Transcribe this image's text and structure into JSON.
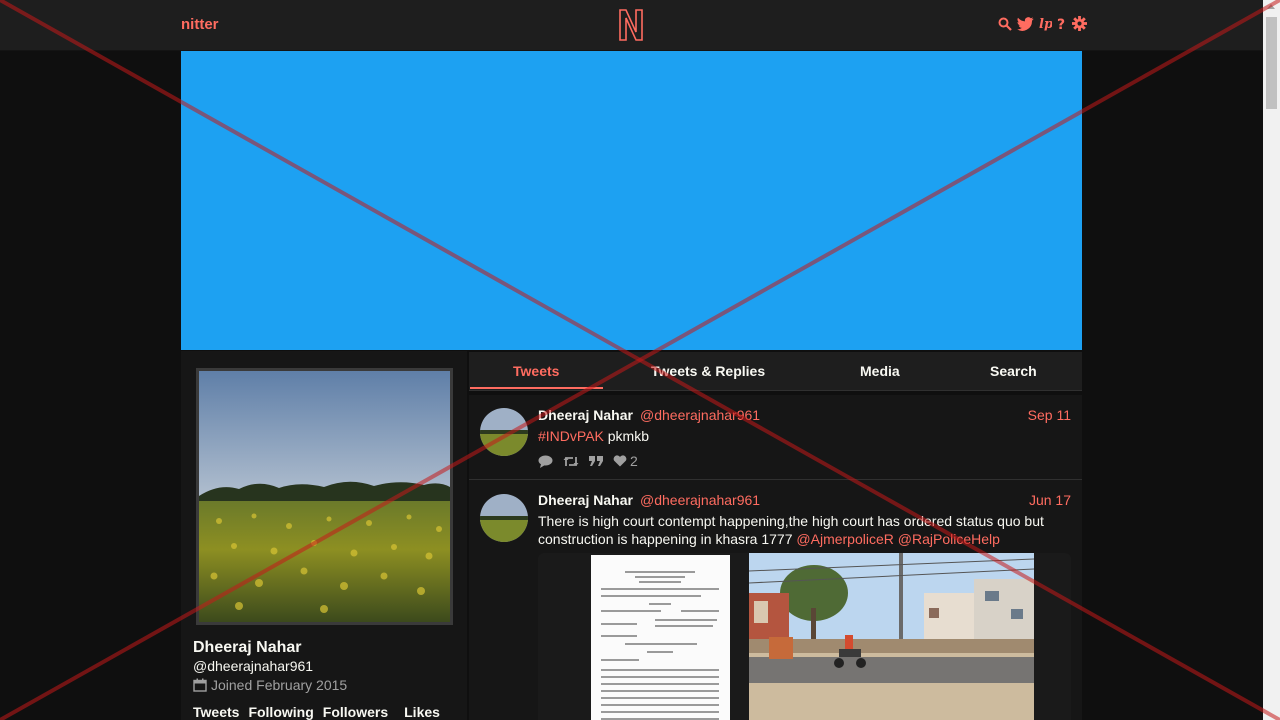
{
  "nav": {
    "brand": "nitter",
    "icons": [
      "search-icon",
      "twitter-icon",
      "liberapay-icon",
      "help-icon",
      "settings-icon"
    ]
  },
  "colors": {
    "accent": "#ff6c60",
    "banner": "#1da1f2",
    "background": "#0f0f0f",
    "panel": "#161616"
  },
  "profile": {
    "fullname": "Dheeraj Nahar",
    "username": "@dheerajnahar961",
    "joined": "Joined February 2015",
    "stats": [
      "Tweets",
      "Following",
      "Followers",
      "Likes"
    ]
  },
  "tabs": [
    "Tweets",
    "Tweets & Replies",
    "Media",
    "Search"
  ],
  "tweets": [
    {
      "name": "Dheeraj Nahar",
      "handle": "@dheerajnahar961",
      "date": "Sep 11",
      "hashtag": "#INDvPAK",
      "text": " pkmkb",
      "likes": "2"
    },
    {
      "name": "Dheeraj Nahar",
      "handle": "@dheerajnahar961",
      "date": "Jun 17",
      "text": "There is high court contempt happening,the high court has ordered status quo but construction is happening in khasra 1777 ",
      "mention1": "@AjmerpoliceR",
      "mention2": "@RajPoliceHelp"
    }
  ]
}
